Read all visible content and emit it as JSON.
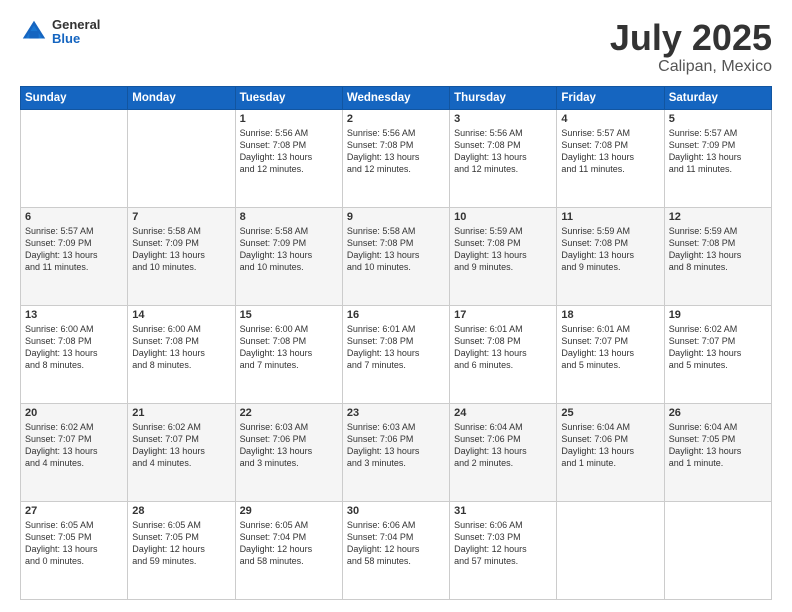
{
  "header": {
    "logo_general": "General",
    "logo_blue": "Blue",
    "month": "July 2025",
    "location": "Calipan, Mexico"
  },
  "days_of_week": [
    "Sunday",
    "Monday",
    "Tuesday",
    "Wednesday",
    "Thursday",
    "Friday",
    "Saturday"
  ],
  "weeks": [
    [
      {
        "day": "",
        "detail": ""
      },
      {
        "day": "",
        "detail": ""
      },
      {
        "day": "1",
        "detail": "Sunrise: 5:56 AM\nSunset: 7:08 PM\nDaylight: 13 hours\nand 12 minutes."
      },
      {
        "day": "2",
        "detail": "Sunrise: 5:56 AM\nSunset: 7:08 PM\nDaylight: 13 hours\nand 12 minutes."
      },
      {
        "day": "3",
        "detail": "Sunrise: 5:56 AM\nSunset: 7:08 PM\nDaylight: 13 hours\nand 12 minutes."
      },
      {
        "day": "4",
        "detail": "Sunrise: 5:57 AM\nSunset: 7:08 PM\nDaylight: 13 hours\nand 11 minutes."
      },
      {
        "day": "5",
        "detail": "Sunrise: 5:57 AM\nSunset: 7:09 PM\nDaylight: 13 hours\nand 11 minutes."
      }
    ],
    [
      {
        "day": "6",
        "detail": "Sunrise: 5:57 AM\nSunset: 7:09 PM\nDaylight: 13 hours\nand 11 minutes."
      },
      {
        "day": "7",
        "detail": "Sunrise: 5:58 AM\nSunset: 7:09 PM\nDaylight: 13 hours\nand 10 minutes."
      },
      {
        "day": "8",
        "detail": "Sunrise: 5:58 AM\nSunset: 7:09 PM\nDaylight: 13 hours\nand 10 minutes."
      },
      {
        "day": "9",
        "detail": "Sunrise: 5:58 AM\nSunset: 7:08 PM\nDaylight: 13 hours\nand 10 minutes."
      },
      {
        "day": "10",
        "detail": "Sunrise: 5:59 AM\nSunset: 7:08 PM\nDaylight: 13 hours\nand 9 minutes."
      },
      {
        "day": "11",
        "detail": "Sunrise: 5:59 AM\nSunset: 7:08 PM\nDaylight: 13 hours\nand 9 minutes."
      },
      {
        "day": "12",
        "detail": "Sunrise: 5:59 AM\nSunset: 7:08 PM\nDaylight: 13 hours\nand 8 minutes."
      }
    ],
    [
      {
        "day": "13",
        "detail": "Sunrise: 6:00 AM\nSunset: 7:08 PM\nDaylight: 13 hours\nand 8 minutes."
      },
      {
        "day": "14",
        "detail": "Sunrise: 6:00 AM\nSunset: 7:08 PM\nDaylight: 13 hours\nand 8 minutes."
      },
      {
        "day": "15",
        "detail": "Sunrise: 6:00 AM\nSunset: 7:08 PM\nDaylight: 13 hours\nand 7 minutes."
      },
      {
        "day": "16",
        "detail": "Sunrise: 6:01 AM\nSunset: 7:08 PM\nDaylight: 13 hours\nand 7 minutes."
      },
      {
        "day": "17",
        "detail": "Sunrise: 6:01 AM\nSunset: 7:08 PM\nDaylight: 13 hours\nand 6 minutes."
      },
      {
        "day": "18",
        "detail": "Sunrise: 6:01 AM\nSunset: 7:07 PM\nDaylight: 13 hours\nand 5 minutes."
      },
      {
        "day": "19",
        "detail": "Sunrise: 6:02 AM\nSunset: 7:07 PM\nDaylight: 13 hours\nand 5 minutes."
      }
    ],
    [
      {
        "day": "20",
        "detail": "Sunrise: 6:02 AM\nSunset: 7:07 PM\nDaylight: 13 hours\nand 4 minutes."
      },
      {
        "day": "21",
        "detail": "Sunrise: 6:02 AM\nSunset: 7:07 PM\nDaylight: 13 hours\nand 4 minutes."
      },
      {
        "day": "22",
        "detail": "Sunrise: 6:03 AM\nSunset: 7:06 PM\nDaylight: 13 hours\nand 3 minutes."
      },
      {
        "day": "23",
        "detail": "Sunrise: 6:03 AM\nSunset: 7:06 PM\nDaylight: 13 hours\nand 3 minutes."
      },
      {
        "day": "24",
        "detail": "Sunrise: 6:04 AM\nSunset: 7:06 PM\nDaylight: 13 hours\nand 2 minutes."
      },
      {
        "day": "25",
        "detail": "Sunrise: 6:04 AM\nSunset: 7:06 PM\nDaylight: 13 hours\nand 1 minute."
      },
      {
        "day": "26",
        "detail": "Sunrise: 6:04 AM\nSunset: 7:05 PM\nDaylight: 13 hours\nand 1 minute."
      }
    ],
    [
      {
        "day": "27",
        "detail": "Sunrise: 6:05 AM\nSunset: 7:05 PM\nDaylight: 13 hours\nand 0 minutes."
      },
      {
        "day": "28",
        "detail": "Sunrise: 6:05 AM\nSunset: 7:05 PM\nDaylight: 12 hours\nand 59 minutes."
      },
      {
        "day": "29",
        "detail": "Sunrise: 6:05 AM\nSunset: 7:04 PM\nDaylight: 12 hours\nand 58 minutes."
      },
      {
        "day": "30",
        "detail": "Sunrise: 6:06 AM\nSunset: 7:04 PM\nDaylight: 12 hours\nand 58 minutes."
      },
      {
        "day": "31",
        "detail": "Sunrise: 6:06 AM\nSunset: 7:03 PM\nDaylight: 12 hours\nand 57 minutes."
      },
      {
        "day": "",
        "detail": ""
      },
      {
        "day": "",
        "detail": ""
      }
    ]
  ]
}
